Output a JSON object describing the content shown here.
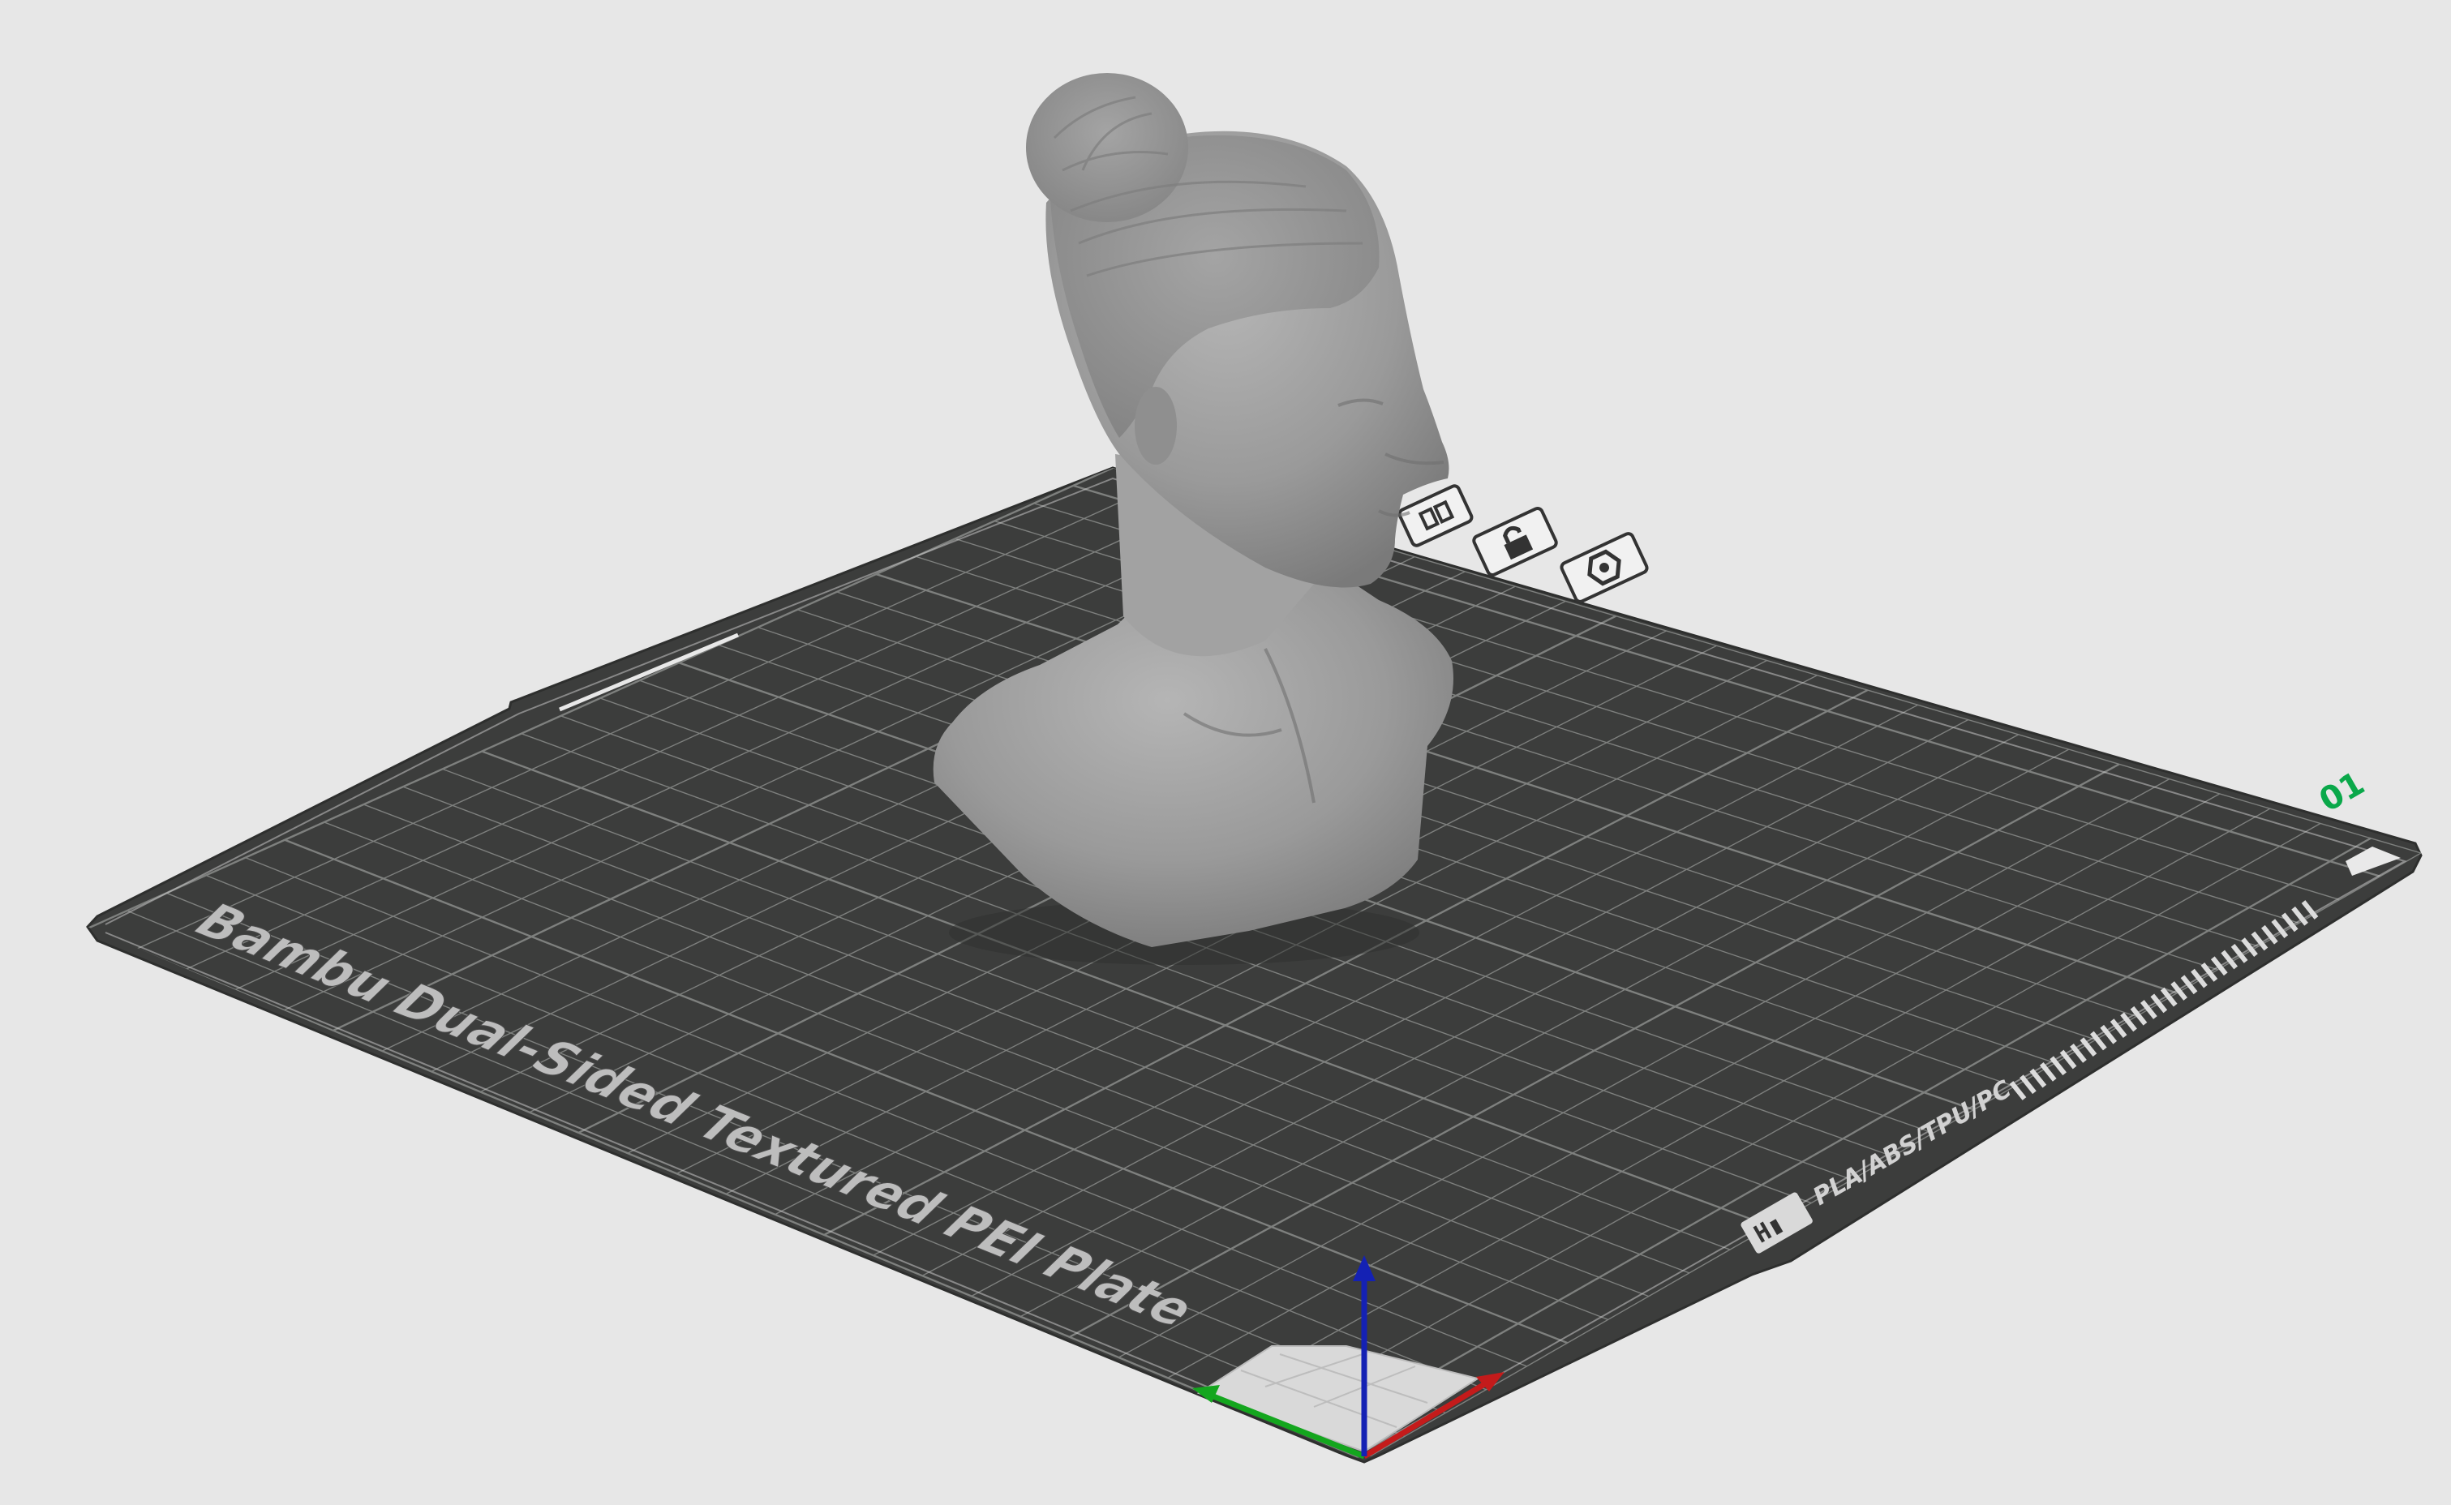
{
  "viewport": {
    "background": "#e7e7e7",
    "plate_color": "#3c3d3c",
    "grid_color": "#8a8c8a",
    "model_color": "#9c9c9c"
  },
  "plate": {
    "name": "Bambu Dual-Sided Textured PEI Plate",
    "filaments": "PLA/ABS/TPU/PC",
    "plate_number": "01",
    "logo": "bambu-lab-logo",
    "accent_color": "#0aa84a"
  },
  "plate_toolbar": {
    "icons": [
      "settings-icon",
      "lock-icon",
      "arrange-icon"
    ]
  },
  "axes": {
    "x_color": "#c41b1b",
    "y_color": "#14a61e",
    "z_color": "#1421b4"
  },
  "model": {
    "object": "female-bust"
  }
}
